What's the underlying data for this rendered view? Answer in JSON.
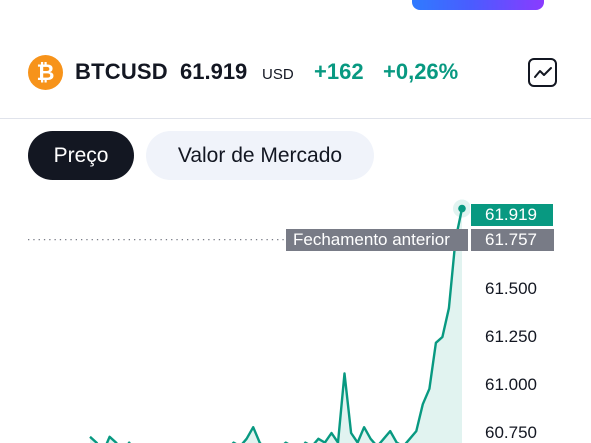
{
  "header": {
    "logo_glyph": "₿",
    "symbol": "BTCUSD",
    "price": "61.919",
    "currency": "USD",
    "change_abs": "+162",
    "change_pct": "+0,26%",
    "chart_type_icon": "line-chart-icon"
  },
  "tabs": [
    {
      "label": "Preço",
      "active": true
    },
    {
      "label": "Valor de Mercado",
      "active": false
    }
  ],
  "colors": {
    "positive": "#089981",
    "dark": "#131722",
    "muted_label": "#787b86",
    "btc_orange": "#f7931a"
  },
  "chart": {
    "last_price_label": "61.919",
    "prev_close_label": "61.757",
    "prev_close_text": "Fechamento anterior",
    "y_ticks": [
      "61.500",
      "61.250",
      "61.000",
      "60.750"
    ]
  },
  "chart_data": {
    "type": "area",
    "last_value": 61919,
    "previous_close": 61757,
    "y_ticks": [
      61500,
      61250,
      61000,
      60750
    ],
    "series": [
      {
        "values": [
          60730,
          60700,
          60650,
          60730,
          60700,
          60650,
          60700,
          60640,
          60680,
          60650,
          60690,
          60640,
          60670,
          60650,
          60630,
          60660,
          60680,
          60640,
          60670,
          60650,
          60690,
          60660,
          60700,
          60680,
          60720,
          60780,
          60700,
          60660,
          60690,
          60670,
          60700,
          60680,
          60650,
          60700,
          60680,
          60720,
          60700,
          60750,
          60700,
          61060,
          60750,
          60700,
          60780,
          60720,
          60680,
          60720,
          60760,
          60700,
          60680,
          60720,
          60760,
          60900,
          60980,
          61220,
          61250,
          61400,
          61757,
          61919
        ]
      }
    ]
  }
}
